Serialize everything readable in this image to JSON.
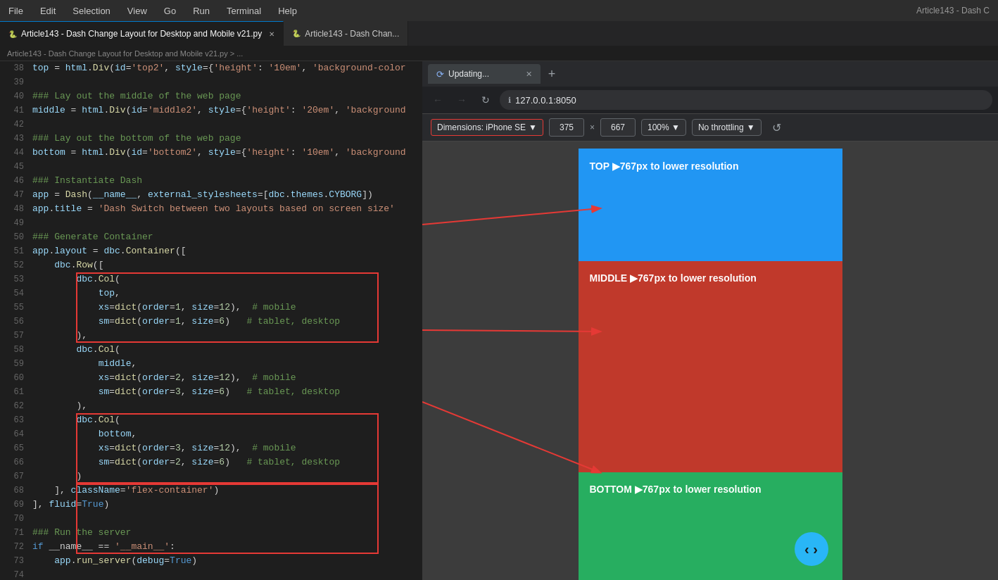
{
  "menubar": {
    "items": [
      "File",
      "Edit",
      "Selection",
      "View",
      "Go",
      "Run",
      "Terminal",
      "Help"
    ],
    "right_title": "Article143 - Dash C"
  },
  "editor": {
    "tabs": [
      {
        "label": "Article143 - Dash Change Layout for Desktop and Mobile v21.py",
        "active": true,
        "icon": "🐍"
      },
      {
        "label": "Article143 - Dash Chan...",
        "active": false,
        "icon": "🐍"
      }
    ],
    "breadcrumb": "Article143 - Dash Change Layout for Desktop and Mobile v21.py > ...",
    "lines": [
      {
        "num": "38",
        "code": "top = html.Div(id='top2', style={'height': '10em', 'background-color"
      },
      {
        "num": "39",
        "code": ""
      },
      {
        "num": "40",
        "code": "### Lay out the middle of the web page"
      },
      {
        "num": "41",
        "code": "middle = html.Div(id='middle2', style={'height': '20em', 'background"
      },
      {
        "num": "42",
        "code": ""
      },
      {
        "num": "43",
        "code": "### Lay out the bottom of the web page"
      },
      {
        "num": "44",
        "code": "bottom = html.Div(id='bottom2', style={'height': '10em', 'background"
      },
      {
        "num": "45",
        "code": ""
      },
      {
        "num": "46",
        "code": "### Instantiate Dash"
      },
      {
        "num": "47",
        "code": "app = Dash(__name__, external_stylesheets=[dbc.themes.CYBORG])"
      },
      {
        "num": "48",
        "code": "app.title = 'Dash Switch between two layouts based on screen size'"
      },
      {
        "num": "49",
        "code": ""
      },
      {
        "num": "50",
        "code": "### Generate Container"
      },
      {
        "num": "51",
        "code": "app.layout = dbc.Container(["
      },
      {
        "num": "52",
        "code": "    dbc.Row(["
      },
      {
        "num": "53",
        "code": "        dbc.Col("
      },
      {
        "num": "54",
        "code": "            top,"
      },
      {
        "num": "55",
        "code": "            xs=dict(order=1, size=12),  # mobile"
      },
      {
        "num": "56",
        "code": "            sm=dict(order=1, size=6)   # tablet, desktop"
      },
      {
        "num": "57",
        "code": "        ),"
      },
      {
        "num": "58",
        "code": "        dbc.Col("
      },
      {
        "num": "59",
        "code": "            middle,"
      },
      {
        "num": "60",
        "code": "            xs=dict(order=2, size=12),  # mobile"
      },
      {
        "num": "61",
        "code": "            sm=dict(order=3, size=6)   # tablet, desktop"
      },
      {
        "num": "62",
        "code": "        ),"
      },
      {
        "num": "63",
        "code": "        dbc.Col("
      },
      {
        "num": "64",
        "code": "            bottom,"
      },
      {
        "num": "65",
        "code": "            xs=dict(order=3, size=12),  # mobile"
      },
      {
        "num": "66",
        "code": "            sm=dict(order=2, size=6)   # tablet, desktop"
      },
      {
        "num": "67",
        "code": "        )"
      },
      {
        "num": "68",
        "code": "    ], className='flex-container')"
      },
      {
        "num": "69",
        "code": "], fluid=True)"
      },
      {
        "num": "70",
        "code": ""
      },
      {
        "num": "71",
        "code": "### Run the server"
      },
      {
        "num": "72",
        "code": "if __name__ == '__main__':"
      },
      {
        "num": "73",
        "code": "    app.run_server(debug=True)"
      },
      {
        "num": "74",
        "code": ""
      }
    ]
  },
  "browser": {
    "tab_label": "Updating...",
    "address": "127.0.0.1:8050",
    "dimensions_label": "Dimensions: iPhone SE",
    "width": "375",
    "height": "667",
    "zoom": "100%",
    "throttle": "No throttling",
    "sections": {
      "top": "TOP ▶767px to lower resolution",
      "middle": "MIDDLE ▶767px to lower resolution",
      "bottom": "BOTTOM ▶767px to lower resolution"
    },
    "nav_button": "‹ ›"
  }
}
